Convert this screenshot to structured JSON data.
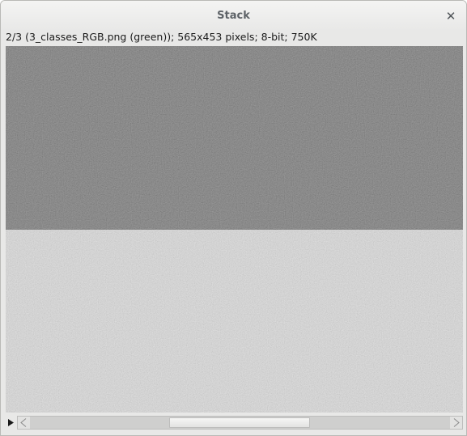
{
  "window": {
    "title": "Stack",
    "close_glyph": "✕"
  },
  "info_line": "2/3 (3_classes_RGB.png (green)); 565x453 pixels; 8-bit; 750K",
  "image": {
    "regions": [
      {
        "name": "dark-class",
        "color": "#707070"
      },
      {
        "name": "light-class",
        "color": "#dcdcdc"
      }
    ]
  },
  "slice_scrollbar": {
    "current_slice": 2,
    "total_slices": 3,
    "play_icon": "play-triangle-icon"
  }
}
